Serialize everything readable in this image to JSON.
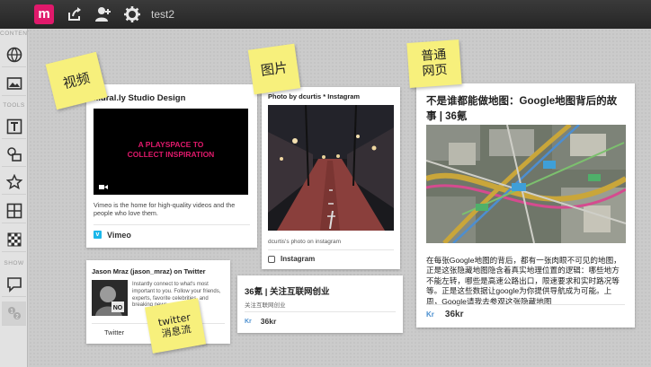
{
  "app": {
    "logo_letter": "m",
    "board_title": "test2"
  },
  "toolbar": {
    "icons": [
      "share-icon",
      "add-user-icon",
      "gear-icon"
    ]
  },
  "sidebar": {
    "content_label": "CONTENT",
    "tools_label": "TOOLS",
    "show_label": "SHOW"
  },
  "notes": {
    "video": "视频",
    "image": "图片",
    "webpage": "普通\n网页",
    "twitter": "twitter\n消息流"
  },
  "video_card": {
    "title": "Mural.ly Studio Design",
    "video_text": "A PLAYSPACE TO COLLECT INSPIRATION",
    "description": "Vimeo is the home for high-quality videos and the people who love them.",
    "source": "Vimeo"
  },
  "photo_card": {
    "title": "Photo by dcurtis * Instagram",
    "caption": "dcurtis's photo on instagram",
    "source": "Instagram"
  },
  "web_card": {
    "title": "不是谁都能做地图：Google地图背后的故事 | 36氪",
    "description": "在每张Google地图的背后，都有一张肉眼不可见的地图，正是这张隐藏地图隐含着真实地理位置的逻辑：哪些地方不能左转，哪些是高速公路出口，限速要求和实时路况等等。正是这些数据让google为你提供导航成为可能。上周，Google请我去参观这张隐藏地图",
    "source_badge": "Kr",
    "source": "36kr"
  },
  "twitter_card": {
    "title": "Jason Mraz (jason_mraz) on Twitter",
    "description": "Instantly connect to what's most important to you. Follow your friends, experts, favorite celebrities, and breaking news",
    "source": "Twitter"
  },
  "kr_card": {
    "title": "36氪 | 关注互联网创业",
    "subtitle": "关注互联网创业",
    "source_badge": "Kr",
    "source": "36kr"
  },
  "colors": {
    "brand": "#e0196b",
    "note": "#f7f07c",
    "vimeo": "#1ab7ea",
    "kr": "#4a8fcf"
  }
}
